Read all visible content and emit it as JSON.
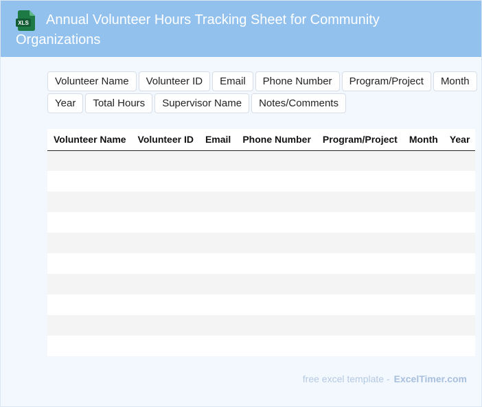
{
  "header": {
    "icon": "xls-file-icon",
    "icon_label": "XLS",
    "title": "Annual Volunteer Hours Tracking Sheet for Community Organizations",
    "background": "#92c1ee",
    "icon_color": "#1e7a45"
  },
  "fields": [
    {
      "label": "Volunteer Name"
    },
    {
      "label": "Volunteer ID"
    },
    {
      "label": "Email"
    },
    {
      "label": "Phone Number"
    },
    {
      "label": "Program/Project"
    },
    {
      "label": "Month"
    },
    {
      "label": "Year"
    },
    {
      "label": "Total Hours"
    },
    {
      "label": "Supervisor Name"
    },
    {
      "label": "Notes/Comments"
    }
  ],
  "table": {
    "columns": [
      "Volunteer Name",
      "Volunteer ID",
      "Email",
      "Phone Number",
      "Program/Project",
      "Month",
      "Year"
    ],
    "rows": [
      [
        "",
        "",
        "",
        "",
        "",
        "",
        ""
      ],
      [
        "",
        "",
        "",
        "",
        "",
        "",
        ""
      ],
      [
        "",
        "",
        "",
        "",
        "",
        "",
        ""
      ],
      [
        "",
        "",
        "",
        "",
        "",
        "",
        ""
      ],
      [
        "",
        "",
        "",
        "",
        "",
        "",
        ""
      ],
      [
        "",
        "",
        "",
        "",
        "",
        "",
        ""
      ],
      [
        "",
        "",
        "",
        "",
        "",
        "",
        ""
      ],
      [
        "",
        "",
        "",
        "",
        "",
        "",
        ""
      ],
      [
        "",
        "",
        "",
        "",
        "",
        "",
        ""
      ],
      [
        "",
        "",
        "",
        "",
        "",
        "",
        ""
      ]
    ]
  },
  "footer": {
    "text": "free excel template -",
    "brand": "ExcelTimer.com"
  }
}
